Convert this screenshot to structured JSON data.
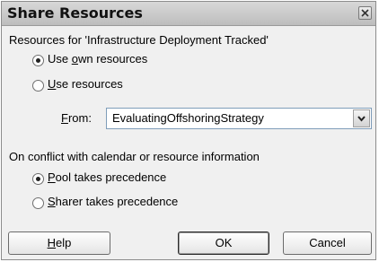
{
  "dialog": {
    "title": "Share Resources"
  },
  "resources_group": {
    "label": "Resources for 'Infrastructure Deployment Tracked'",
    "own_option": {
      "pre": "Use ",
      "mnemonic": "o",
      "post": "wn resources",
      "checked": true
    },
    "shared_option": {
      "pre": "",
      "mnemonic": "U",
      "post": "se resources",
      "checked": false
    },
    "from_label": {
      "mnemonic": "F",
      "post": "rom:"
    },
    "from_value": "EvaluatingOffshoringStrategy"
  },
  "conflict_group": {
    "label": "On conflict with calendar or resource information",
    "pool_option": {
      "mnemonic": "P",
      "post": "ool takes precedence",
      "checked": true
    },
    "sharer_option": {
      "mnemonic": "S",
      "post": "harer takes precedence",
      "checked": false
    }
  },
  "buttons": {
    "help": {
      "mnemonic": "H",
      "post": "elp"
    },
    "ok": "OK",
    "cancel": "Cancel"
  }
}
